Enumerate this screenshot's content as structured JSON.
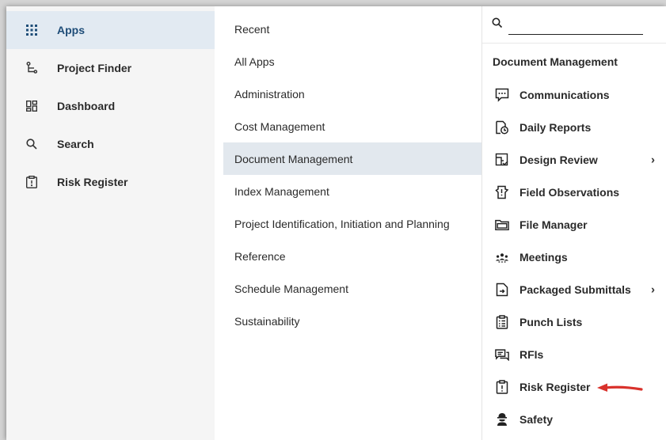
{
  "nav": {
    "items": [
      {
        "label": "Apps",
        "icon": "grid-icon",
        "active": true
      },
      {
        "label": "Project Finder",
        "icon": "tree-icon"
      },
      {
        "label": "Dashboard",
        "icon": "dashboard-icon"
      },
      {
        "label": "Search",
        "icon": "search-icon"
      },
      {
        "label": "Risk Register",
        "icon": "clipboard-alert-icon"
      }
    ]
  },
  "categories": {
    "items": [
      "Recent",
      "All Apps",
      "Administration",
      "Cost Management",
      "Document Management",
      "Index Management",
      "Project Identification, Initiation and Planning",
      "Reference",
      "Schedule Management",
      "Sustainability"
    ],
    "selected": "Document Management"
  },
  "apps": {
    "search": {
      "value": "",
      "placeholder": ""
    },
    "group_title": "Document Management",
    "items": [
      {
        "label": "Communications",
        "icon": "chat-icon"
      },
      {
        "label": "Daily Reports",
        "icon": "daily-report-icon"
      },
      {
        "label": "Design Review",
        "icon": "design-review-icon",
        "has_submenu": true
      },
      {
        "label": "Field Observations",
        "icon": "field-observation-icon"
      },
      {
        "label": "File Manager",
        "icon": "folder-icon"
      },
      {
        "label": "Meetings",
        "icon": "meetings-icon"
      },
      {
        "label": "Packaged Submittals",
        "icon": "package-icon",
        "has_submenu": true
      },
      {
        "label": "Punch Lists",
        "icon": "checklist-icon"
      },
      {
        "label": "RFIs",
        "icon": "rfi-icon"
      },
      {
        "label": "Risk Register",
        "icon": "clipboard-alert-icon"
      },
      {
        "label": "Safety",
        "icon": "safety-icon"
      }
    ],
    "chevron": "›"
  },
  "colors": {
    "active_bg": "#e2eaf2",
    "active_text": "#1f4d78",
    "selected_bg": "#e2e8ee",
    "arrow": "#d9322c"
  }
}
